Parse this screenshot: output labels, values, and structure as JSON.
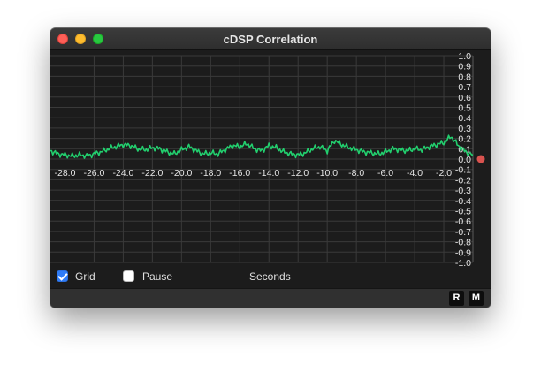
{
  "window": {
    "title": "cDSP Correlation"
  },
  "controls": {
    "grid_label": "Grid",
    "grid_checked": true,
    "pause_label": "Pause",
    "pause_checked": false,
    "axis_unit_label": "Seconds"
  },
  "buttons": {
    "r_label": "R",
    "m_label": "M"
  },
  "colors": {
    "trace": "#22cf6e",
    "background": "#1c1c1c",
    "grid": "#3a3a3a",
    "indicator": "#d9534f"
  },
  "chart_data": {
    "type": "line",
    "title": "",
    "xlabel": "Seconds",
    "ylabel": "",
    "xlim": [
      -29.0,
      0.0
    ],
    "ylim": [
      -1.0,
      1.0
    ],
    "grid": true,
    "x_ticks": [
      -28.0,
      -26.0,
      -24.0,
      -22.0,
      -20.0,
      -18.0,
      -16.0,
      -14.0,
      -12.0,
      -10.0,
      -8.0,
      -6.0,
      -4.0,
      -2.0
    ],
    "x_tick_labels": [
      "-28.0",
      "-26.0",
      "-24.0",
      "-22.0",
      "-20.0",
      "-18.0",
      "-16.0",
      "-14.0",
      "-12.0",
      "-10.0",
      "-8.0",
      "-6.0",
      "-4.0",
      "-2.0"
    ],
    "y_ticks": [
      1.0,
      0.9,
      0.8,
      0.7,
      0.6,
      0.5,
      0.4,
      0.3,
      0.2,
      0.1,
      0.0,
      -0.1,
      -0.2,
      -0.3,
      -0.4,
      -0.5,
      -0.6,
      -0.7,
      -0.8,
      -0.9,
      -1.0
    ],
    "y_tick_labels": [
      "1.0",
      "0.9",
      "0.8",
      "0.7",
      "0.6",
      "0.5",
      "0.4",
      "0.3",
      "0.2",
      "0.1",
      "0.0",
      "-0.1",
      "-0.2",
      "-0.3",
      "-0.4",
      "-0.5",
      "-0.6",
      "-0.7",
      "-0.8",
      "-0.9",
      "-1.0"
    ],
    "current_value": 0.0,
    "series": [
      {
        "x": [
          -29.0,
          -28.5,
          -28.0,
          -27.5,
          -27.0,
          -26.5,
          -26.0,
          -25.5,
          -25.0,
          -24.5,
          -24.0,
          -23.5,
          -23.0,
          -22.5,
          -22.0,
          -21.5,
          -21.0,
          -20.5,
          -20.0,
          -19.5,
          -19.0,
          -18.5,
          -18.0,
          -17.5,
          -17.0,
          -16.5,
          -16.0,
          -15.5,
          -15.0,
          -14.5,
          -14.0,
          -13.5,
          -13.0,
          -12.5,
          -12.0,
          -11.5,
          -11.0,
          -10.5,
          -10.0,
          -9.5,
          -9.0,
          -8.5,
          -8.0,
          -7.5,
          -7.0,
          -6.5,
          -6.0,
          -5.5,
          -5.0,
          -4.5,
          -4.0,
          -3.5,
          -3.0,
          -2.5,
          -2.0,
          -1.5,
          -1.0,
          -0.5,
          0.0
        ],
        "y": [
          0.08,
          0.05,
          0.04,
          0.03,
          0.04,
          0.03,
          0.05,
          0.07,
          0.1,
          0.12,
          0.14,
          0.13,
          0.1,
          0.09,
          0.11,
          0.1,
          0.07,
          0.05,
          0.09,
          0.12,
          0.08,
          0.05,
          0.06,
          0.05,
          0.09,
          0.13,
          0.12,
          0.15,
          0.1,
          0.08,
          0.13,
          0.11,
          0.07,
          0.05,
          0.04,
          0.06,
          0.1,
          0.12,
          0.08,
          0.18,
          0.14,
          0.11,
          0.09,
          0.07,
          0.06,
          0.05,
          0.07,
          0.1,
          0.09,
          0.08,
          0.1,
          0.09,
          0.12,
          0.14,
          0.16,
          0.22,
          0.13,
          0.07,
          0.04
        ]
      }
    ]
  }
}
